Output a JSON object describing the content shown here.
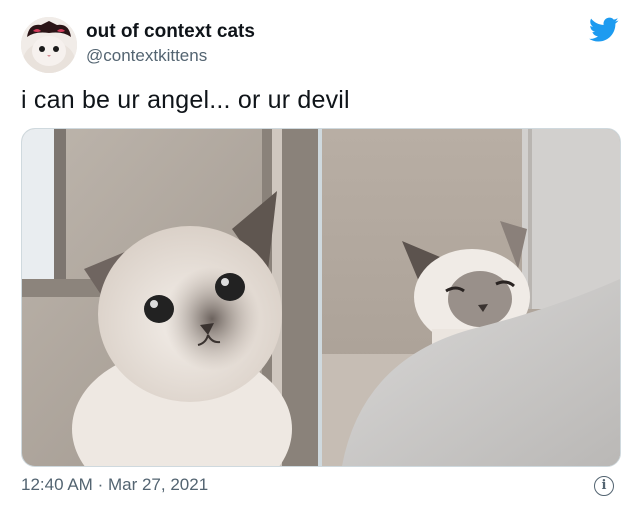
{
  "author": {
    "display_name": "out of context cats",
    "handle": "@contextkittens"
  },
  "platform_icon": "twitter-bird-icon",
  "tweet": {
    "text": "i can be ur angel... or ur devil",
    "time": "12:40 AM",
    "separator": "·",
    "date": "Mar 27, 2021"
  },
  "media": [
    {
      "subject": "siamese kitten looking up sweetly"
    },
    {
      "subject": "siamese kitten peeking with narrowed eyes"
    }
  ],
  "info_icon": "info-icon",
  "colors": {
    "twitter_blue": "#1d9bf0",
    "secondary_text": "#536471",
    "border": "#cfd9de"
  }
}
